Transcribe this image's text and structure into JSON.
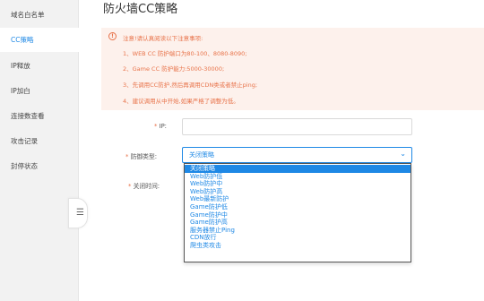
{
  "sidebar": {
    "items": [
      {
        "label": "域名白名单"
      },
      {
        "label": "CC策略"
      },
      {
        "label": "IP释放"
      },
      {
        "label": "IP加白"
      },
      {
        "label": "连接数查看"
      },
      {
        "label": "攻击记录"
      },
      {
        "label": "封停状态"
      }
    ],
    "active_index": 1,
    "collapse_icon": "menu-icon"
  },
  "page": {
    "title": "防火墙CC策略"
  },
  "notice": {
    "icon": "warning-icon",
    "lines": [
      "注意!请认真阅读以下注意事项:",
      "1、WEB CC 防护端口为80-100、8080-8090;",
      "2、Game CC 防护能力:5000-30000;",
      "3、先调用CC防护,然后再调用CDN类或者禁止ping;",
      "4、建议调用从中开始,如果严格了调整为低。"
    ]
  },
  "form": {
    "required_mark": "*",
    "ip_label": "IP:",
    "ip_value": "",
    "type_label": "防御类型:",
    "type_value": "关闭策略",
    "close_time_label": "关闭时间:"
  },
  "dropdown": {
    "selected_index": 0,
    "options": [
      "关闭策略",
      "Web防护低",
      "Web防护中",
      "Web防护高",
      "Web最新防护",
      "Game防护低",
      "Game防护中",
      "Game防护高",
      "服务器禁止Ping",
      "CDN放行",
      "爬虫类攻击"
    ]
  },
  "colors": {
    "accent": "#1e88e5",
    "warning": "#e8734a",
    "notice_bg": "#fdf1ec"
  }
}
